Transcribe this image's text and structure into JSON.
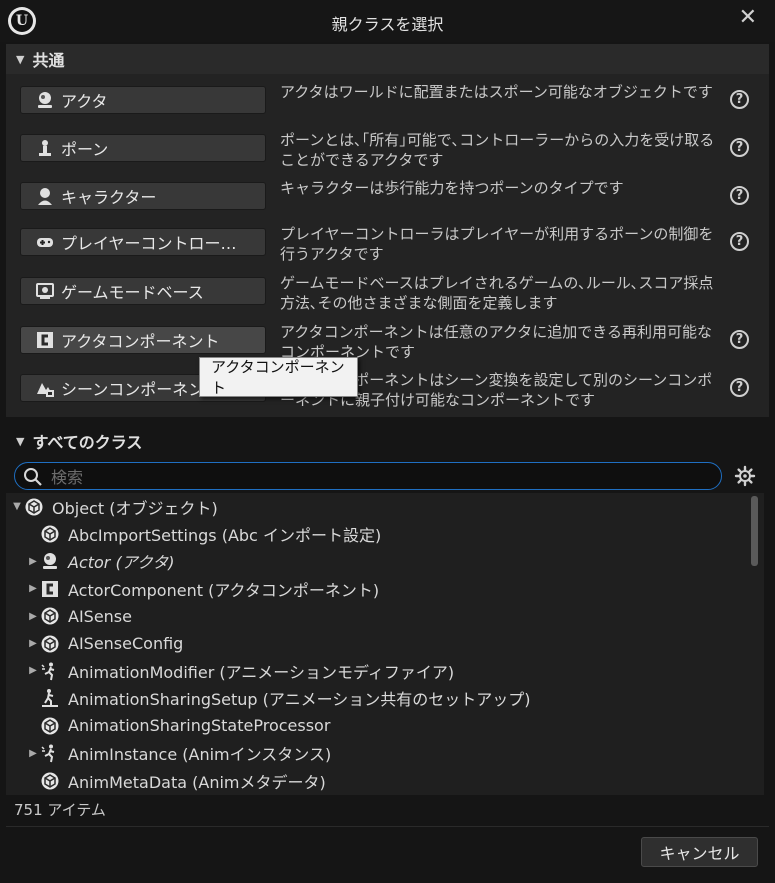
{
  "window": {
    "title": "親クラスを選択"
  },
  "common": {
    "header": "共通",
    "items": [
      {
        "label": "アクタ",
        "desc": "アクタはワールドに配置またはスポーン可能なオブジェクトです",
        "has_help": true
      },
      {
        "label": "ポーン",
        "desc": "ポーンとは､｢所有｣可能で､コントローラーからの入力を受け取ることができるアクタです",
        "has_help": true
      },
      {
        "label": "キャラクター",
        "desc": "キャラクターは歩行能力を持つポーンのタイプです",
        "has_help": true
      },
      {
        "label": "プレイヤーコントロー…",
        "desc": "プレイヤーコントローラはプレイヤーが利用するポーンの制御を行うアクタです",
        "has_help": true
      },
      {
        "label": "ゲームモードベース",
        "desc": "ゲームモードベースはプレイされるゲームの､ルール､スコア採点方法､その他さまざまな側面を定義します",
        "has_help": false
      },
      {
        "label": "アクタコンポーネント",
        "desc": "アクタコンポーネントは任意のアクタに追加できる再利用可能なコンポーネントです",
        "has_help": true
      },
      {
        "label": "シーンコンポーネント",
        "desc": "シーンコンポーネントはシーン変換を設定して別のシーンコンポーネントに親子付け可能なコンポーネントです",
        "has_help": true
      }
    ],
    "tooltip": "アクタコンポーネント"
  },
  "all_classes": {
    "header": "すべてのクラス",
    "search_placeholder": "検索",
    "tree": [
      {
        "label": "Object (オブジェクト)",
        "arrow": "expanded",
        "icon": "cube-icon",
        "indent": 0
      },
      {
        "label": "AbcImportSettings (Abc インポート設定)",
        "arrow": "none",
        "icon": "cube-icon",
        "indent": 1
      },
      {
        "label": "Actor (アクタ)",
        "arrow": "collapsed",
        "icon": "actor-icon",
        "indent": 1,
        "italic": true
      },
      {
        "label": "ActorComponent (アクタコンポーネント)",
        "arrow": "collapsed",
        "icon": "component-icon",
        "indent": 1
      },
      {
        "label": "AISense",
        "arrow": "collapsed",
        "icon": "cube-icon",
        "indent": 1
      },
      {
        "label": "AISenseConfig",
        "arrow": "collapsed",
        "icon": "cube-icon",
        "indent": 1
      },
      {
        "label": "AnimationModifier (アニメーションモディファイア)",
        "arrow": "collapsed",
        "icon": "anim-modifier-icon",
        "indent": 1
      },
      {
        "label": "AnimationSharingSetup (アニメーション共有のセットアップ)",
        "arrow": "none",
        "icon": "anim-sharing-icon",
        "indent": 1
      },
      {
        "label": "AnimationSharingStateProcessor",
        "arrow": "none",
        "icon": "cube-icon",
        "indent": 1
      },
      {
        "label": "AnimInstance (Animインスタンス)",
        "arrow": "collapsed",
        "icon": "anim-modifier-icon",
        "indent": 1
      },
      {
        "label": "AnimMetaData (Animメタデータ)",
        "arrow": "none",
        "icon": "cube-icon",
        "indent": 1
      }
    ],
    "count": "751 アイテム"
  },
  "footer": {
    "cancel_label": "キャンセル"
  }
}
